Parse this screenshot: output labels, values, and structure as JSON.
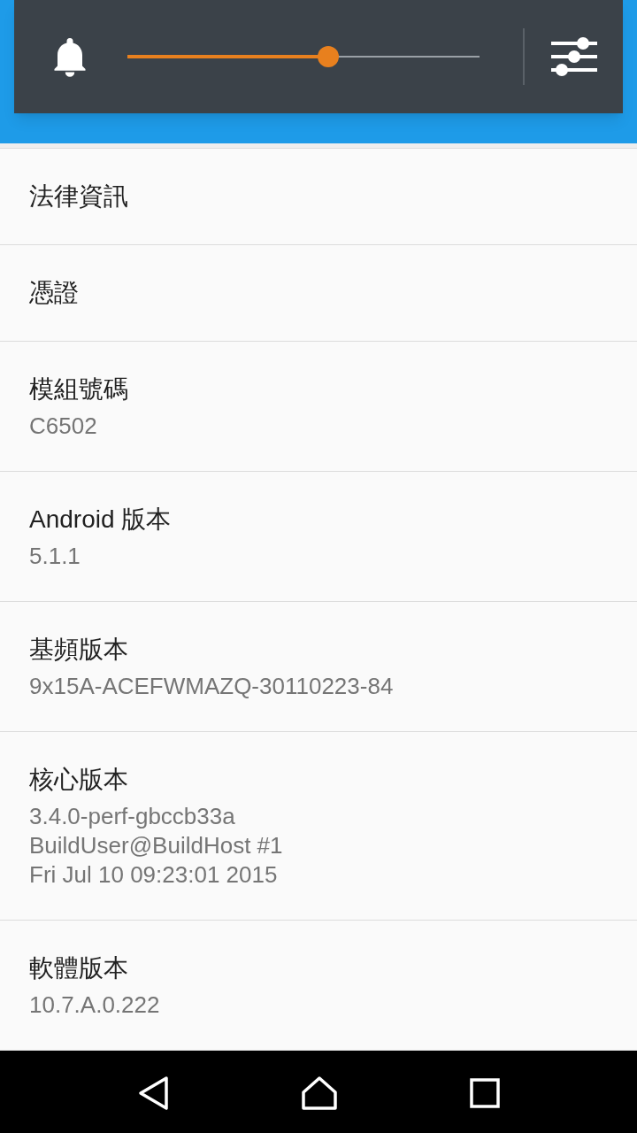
{
  "volume_panel": {
    "level": 0.57
  },
  "items": [
    {
      "title": "法律資訊"
    },
    {
      "title": "憑證"
    },
    {
      "title": "模組號碼",
      "summary": [
        "C6502"
      ]
    },
    {
      "title": "Android 版本",
      "summary": [
        "5.1.1"
      ]
    },
    {
      "title": "基頻版本",
      "summary": [
        "9x15A-ACEFWMAZQ-30110223-84"
      ]
    },
    {
      "title": "核心版本",
      "summary": [
        "3.4.0-perf-gbccb33a",
        "BuildUser@BuildHost #1",
        "Fri Jul 10 09:23:01 2015"
      ]
    },
    {
      "title": "軟體版本",
      "summary": [
        "10.7.A.0.222"
      ]
    }
  ]
}
